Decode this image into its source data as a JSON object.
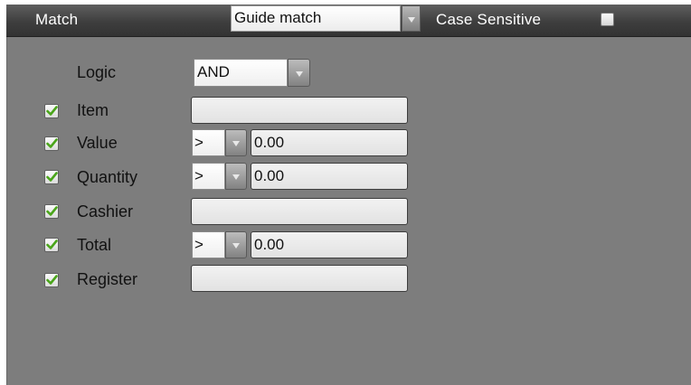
{
  "header": {
    "match_label": "Match",
    "match_select_value": "Guide match",
    "case_sensitive_label": "Case Sensitive",
    "case_sensitive_checked": false
  },
  "logic": {
    "label": "Logic",
    "value": "AND"
  },
  "rows": [
    {
      "label": "Item",
      "checked": true,
      "value": ""
    },
    {
      "label": "Value",
      "checked": true,
      "operator": ">",
      "value": "0.00"
    },
    {
      "label": "Quantity",
      "checked": true,
      "operator": ">",
      "value": "0.00"
    },
    {
      "label": "Cashier",
      "checked": true,
      "value": ""
    },
    {
      "label": "Total",
      "checked": true,
      "operator": ">",
      "value": "0.00"
    },
    {
      "label": "Register",
      "checked": true,
      "value": ""
    }
  ],
  "colors": {
    "panel_bg": "#7d7d7d",
    "header_bg": "#3e3e3e",
    "check_green": "#4aa51a"
  },
  "icons": {
    "checkbox_checked": "green-checkmark-icon",
    "dropdown_arrow": "triangle-down-icon"
  }
}
